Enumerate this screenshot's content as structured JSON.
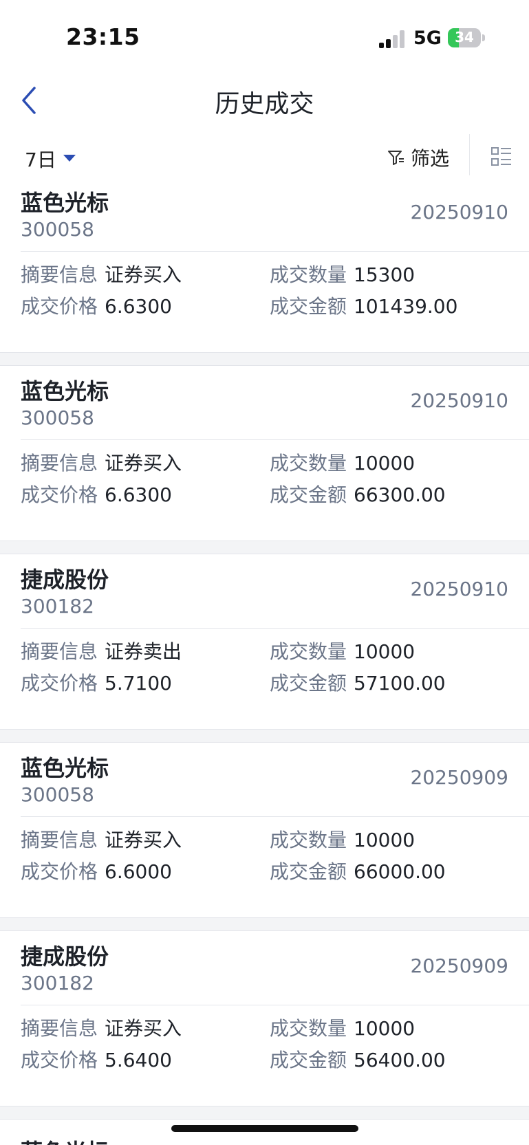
{
  "status_bar": {
    "time": "23:15",
    "network": "5G",
    "battery": "34"
  },
  "nav": {
    "title": "历史成交"
  },
  "filter_bar": {
    "period": "7日",
    "filter_label": "筛选"
  },
  "labels": {
    "summary": "摘要信息",
    "quantity": "成交数量",
    "price": "成交价格",
    "amount": "成交金额"
  },
  "trades": [
    {
      "name": "蓝色光标",
      "code": "300058",
      "date": "20250910",
      "summary": "证券买入",
      "quantity": "15300",
      "price": "6.6300",
      "amount": "101439.00"
    },
    {
      "name": "蓝色光标",
      "code": "300058",
      "date": "20250910",
      "summary": "证券买入",
      "quantity": "10000",
      "price": "6.6300",
      "amount": "66300.00"
    },
    {
      "name": "捷成股份",
      "code": "300182",
      "date": "20250910",
      "summary": "证券卖出",
      "quantity": "10000",
      "price": "5.7100",
      "amount": "57100.00"
    },
    {
      "name": "蓝色光标",
      "code": "300058",
      "date": "20250909",
      "summary": "证券买入",
      "quantity": "10000",
      "price": "6.6000",
      "amount": "66000.00"
    },
    {
      "name": "捷成股份",
      "code": "300182",
      "date": "20250909",
      "summary": "证券买入",
      "quantity": "10000",
      "price": "5.6400",
      "amount": "56400.00"
    }
  ],
  "partial_next": {
    "name": "蓝色光标"
  },
  "colors": {
    "accent": "#2b4db3",
    "text_primary": "#1e2229",
    "text_secondary": "#6b7588",
    "battery_green": "#34c759"
  }
}
